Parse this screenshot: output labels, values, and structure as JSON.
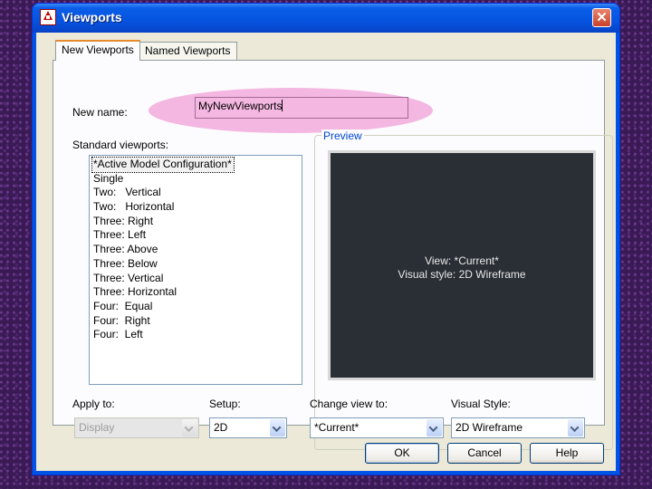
{
  "window": {
    "title": "Viewports",
    "close_glyph": "✕"
  },
  "tabs": [
    {
      "label": "New Viewports",
      "active": true
    },
    {
      "label": "Named Viewports",
      "active": false
    }
  ],
  "new_name": {
    "label": "New name:",
    "value": "MyNewViewports"
  },
  "standard_viewports": {
    "label": "Standard viewports:",
    "selected_index": 0,
    "items": [
      "*Active Model Configuration*",
      "Single",
      "Two:   Vertical",
      "Two:   Horizontal",
      "Three: Right",
      "Three: Left",
      "Three: Above",
      "Three: Below",
      "Three: Vertical",
      "Three: Horizontal",
      "Four:  Equal",
      "Four:  Right",
      "Four:  Left"
    ]
  },
  "preview": {
    "label": "Preview",
    "line1": "View: *Current*",
    "line2": "Visual style: 2D Wireframe"
  },
  "apply_to": {
    "label": "Apply to:",
    "value": "Display",
    "enabled": false
  },
  "setup": {
    "label": "Setup:",
    "value": "2D"
  },
  "change_view_to": {
    "label": "Change view to:",
    "value": "*Current*"
  },
  "visual_style": {
    "label": "Visual Style:",
    "value": "2D Wireframe"
  },
  "buttons": {
    "ok": "OK",
    "cancel": "Cancel",
    "help": "Help"
  },
  "colors": {
    "title_bar": "#0054e3",
    "highlight": "#f3b3df",
    "preview_bg": "#2a2f36"
  }
}
